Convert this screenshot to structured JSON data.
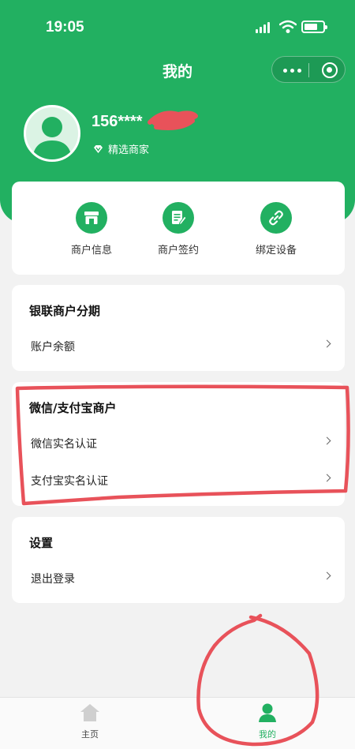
{
  "status_bar": {
    "time": "19:05"
  },
  "nav": {
    "title": "我的",
    "more_icon": "more-dots-icon",
    "close_icon": "miniprogram-target-icon"
  },
  "profile": {
    "phone": "156****",
    "merchant_tag": "精选商家"
  },
  "quick_actions": [
    {
      "label": "商户信息",
      "icon": "storefront-icon"
    },
    {
      "label": "商户签约",
      "icon": "contract-icon"
    },
    {
      "label": "绑定设备",
      "icon": "link-icon"
    }
  ],
  "sections": {
    "unionpay": {
      "title": "银联商户分期",
      "rows": [
        "账户余额"
      ]
    },
    "wechat_alipay": {
      "title": "微信/支付宝商户",
      "rows": [
        "微信实名认证",
        "支付宝实名认证"
      ]
    },
    "settings": {
      "title": "设置",
      "rows": [
        "退出登录"
      ]
    }
  },
  "tabbar": {
    "items": [
      {
        "label": "主页",
        "icon": "home-icon",
        "active": false
      },
      {
        "label": "我的",
        "icon": "profile-icon",
        "active": true
      }
    ]
  },
  "colors": {
    "brand": "#22b061",
    "background": "#f2f2f2",
    "annotation": "#e8525a"
  }
}
